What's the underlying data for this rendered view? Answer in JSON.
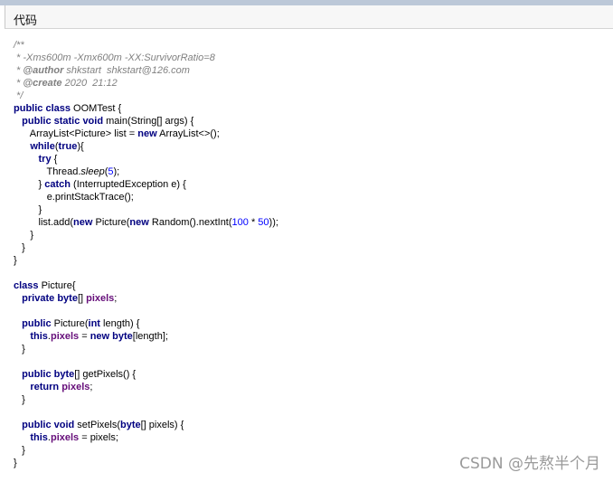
{
  "panel": {
    "title": "代码"
  },
  "code": {
    "l1": "/**",
    "l2": " * -Xms600m -Xmx600m -XX:SurvivorRatio=8",
    "l3_prefix": " * ",
    "l3_tag": "@author",
    "l3_text": " shkstart  shkstart@126.com",
    "l4_prefix": " * ",
    "l4_tag": "@create",
    "l4_text": " 2020  21:12",
    "l5": " */",
    "kw_public": "public",
    "kw_class": "class",
    "kw_static": "static",
    "kw_void": "void",
    "kw_new": "new",
    "kw_while": "while",
    "kw_true": "true",
    "kw_try": "try",
    "kw_catch": "catch",
    "kw_private": "private",
    "kw_byte": "byte",
    "kw_int": "int",
    "kw_this": "this",
    "kw_return": "return",
    "fld_pixels": "pixels",
    "num_5": "5",
    "num_100": "100",
    "num_50": "50",
    "oom_class_name": " OOMTest {",
    "main_sig": " main(String[] args) {",
    "list_decl": "ArrayList<Picture> list = ",
    "list_new": " ArrayList<>();",
    "while_open": "(",
    "while_close": "){",
    "try_open": " {",
    "sleep_pre": "Thread.",
    "sleep_name": "sleep",
    "sleep_open": "(",
    "sleep_close": ");",
    "catch_pre": "} ",
    "catch_post": " (InterruptedException e) {",
    "print_trace": "e.printStackTrace();",
    "close_brace": "}",
    "add_pre": "list.add(",
    "add_mid": " Picture(",
    "add_mid2": " Random().nextInt(",
    "add_mul": " * ",
    "add_end": "));",
    "picture_class": " Picture{",
    "arr_bracket": "[] ",
    "semicolon": ";",
    "ctor_pre": " Picture(",
    "ctor_post": " length) {",
    "assign_eq": " = ",
    "arr_len": "[length];",
    "getter_post": "[] getPixels() {",
    "setter_pre": " setPixels(",
    "setter_post": "[] pixels) {",
    "assign_pixels": " = pixels;",
    "dot": "."
  },
  "watermark": {
    "text": "CSDN @先熬半个月"
  }
}
